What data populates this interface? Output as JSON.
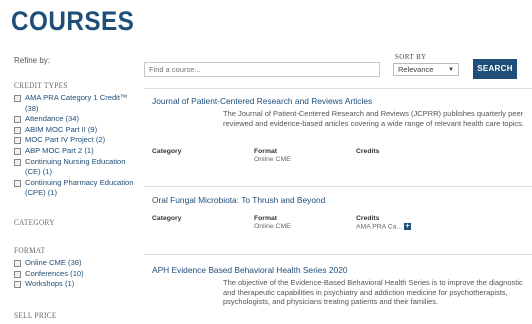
{
  "page": {
    "title": "COURSES"
  },
  "sidebar": {
    "refine_label": "Refine by:",
    "facets": {
      "credit_types": {
        "heading": "CREDIT TYPES",
        "items": [
          "AMA PRA Category 1 Credit™ (38)",
          "Attendance (34)",
          "ABIM MOC Part II (9)",
          "MOC Part IV Project (2)",
          "ABP MOC Part 2 (1)",
          "Continuing Nursing Education (CE) (1)",
          "Continuing Pharmacy Education (CPE) (1)"
        ]
      },
      "category": {
        "heading": "CATEGORY"
      },
      "format": {
        "heading": "FORMAT",
        "items": [
          "Online CME (38)",
          "Conferences (10)",
          "Workshops (1)"
        ]
      },
      "sell_price": {
        "heading": "SELL PRICE"
      }
    }
  },
  "search": {
    "placeholder": "Find a course...",
    "sort_label": "SORT BY",
    "sort_value": "Relevance",
    "button_label": "SEARCH"
  },
  "meta_labels": {
    "category": "Category",
    "format": "Format",
    "credits": "Credits"
  },
  "courses": [
    {
      "title": "Journal of Patient-Centered Research and Reviews Articles",
      "description": "The Journal of Patient-Centered Research and Reviews (JCPRR) publishes quarterly peer reviewed and evidence-based articles covering a wide range of relevant health care topics.",
      "category": "",
      "format": "Online CME",
      "credits": ""
    },
    {
      "title": "Oral Fungal Microbiota: To Thrush and Beyond",
      "description": "",
      "category": "",
      "format": "Online CME",
      "credits": "AMA PRA Ca..."
    },
    {
      "title": "APH Evidence Based Behavioral Health Series 2020",
      "description": "The objective of the Evidence-Based Behavioral Health Series is to improve the diagnostic and therapeutic capabilities in psychiatry and addiction medicine for psychotherapists, psychologists, and physicians treating patients and their families.",
      "category": "",
      "format": "",
      "credits": ""
    }
  ],
  "colors": {
    "brand": "#1f4e79",
    "text": "#444444",
    "border": "#dcdcdc"
  },
  "icons": {
    "expand_credits": "plus-icon",
    "sort_caret": "caret-down-icon"
  }
}
